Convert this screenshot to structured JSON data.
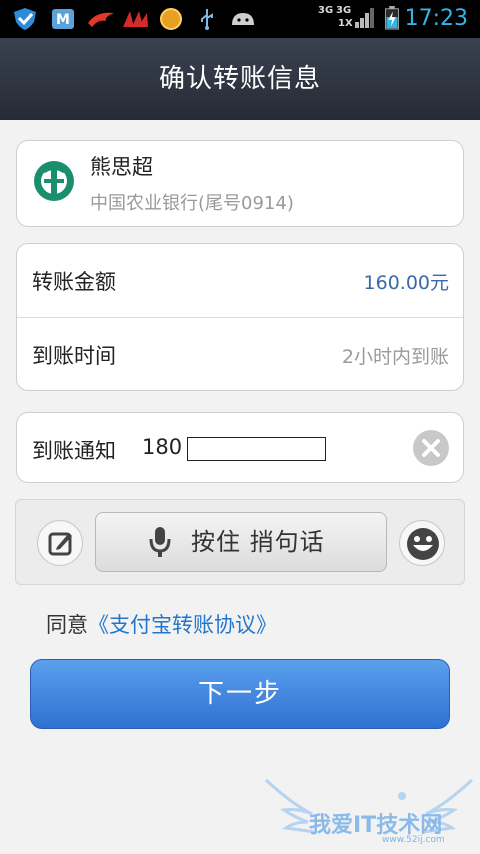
{
  "status_bar": {
    "network_labels": [
      "3G",
      "3G",
      "1X"
    ],
    "time": "17:23",
    "icons": [
      "shield-icon",
      "app-m-icon",
      "phoenix-icon",
      "fan-icon",
      "coin-icon",
      "usb-icon",
      "android-icon",
      "signal-icon",
      "signal-icon",
      "battery-charging-icon"
    ],
    "accent_color": "#33b5e5"
  },
  "header": {
    "title": "确认转账信息"
  },
  "payee": {
    "name": "熊思超",
    "bank": "中国农业银行(尾号0914)",
    "bank_icon": "abc-bank-logo",
    "bank_color": "#1a8f6e"
  },
  "transfer": {
    "amount_label": "转账金额",
    "amount_value": "160.00元",
    "amount_color": "#3b6aa8",
    "time_label": "到账时间",
    "time_value": "2小时内到账"
  },
  "notify": {
    "label": "到账通知",
    "phone_prefix": "180",
    "phone_rest": ""
  },
  "input_bar": {
    "voice_label": "按住 捎句话",
    "icons": [
      "edit-icon",
      "microphone-icon",
      "smiley-icon"
    ]
  },
  "agreement": {
    "prefix": "同意",
    "link": "《支付宝转账协议》",
    "link_color": "#2277cc"
  },
  "next_button": {
    "label": "下一步",
    "color": "#3a7fdc"
  },
  "watermark": {
    "text": "我爱IT技术网",
    "url": "www.52ij.com"
  }
}
